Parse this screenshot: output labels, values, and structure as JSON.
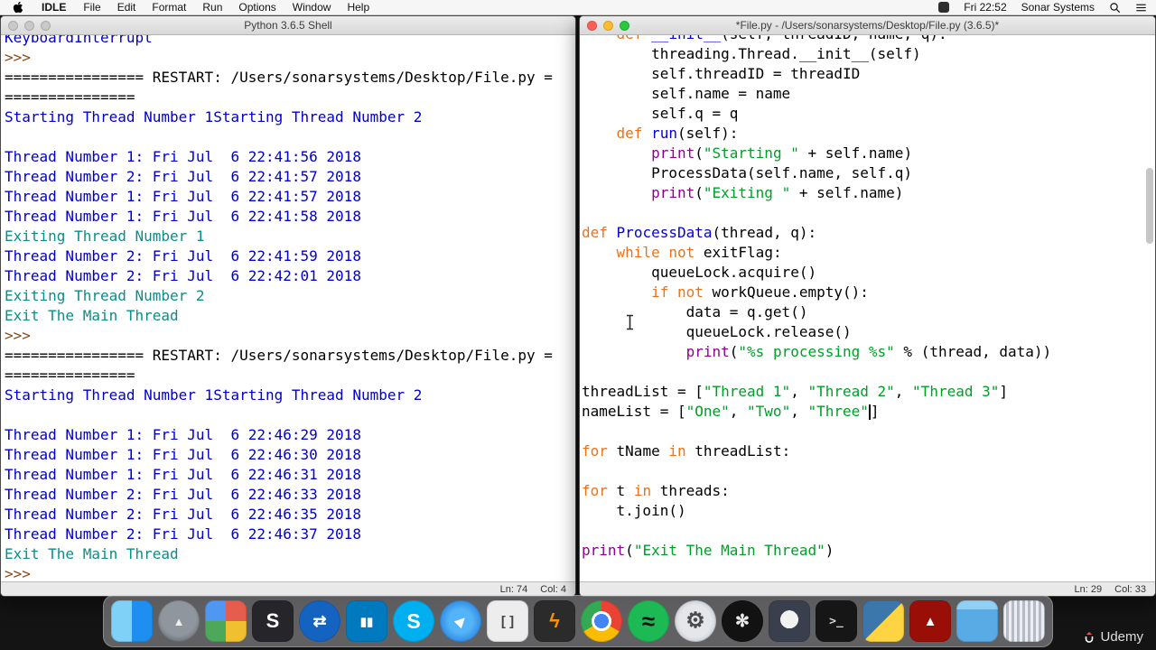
{
  "menubar": {
    "app": "IDLE",
    "menus": [
      "File",
      "Edit",
      "Format",
      "Run",
      "Options",
      "Window",
      "Help"
    ],
    "right": {
      "time": "Fri 22:52",
      "user": "Sonar Systems"
    }
  },
  "colors": {
    "kw": "#e8731c",
    "def": "#0000e0",
    "str": "#00a028",
    "bi": "#900090",
    "pl": "#000000",
    "out": "#0000cd",
    "ex": "#0e8c86",
    "pr": "#8b4513"
  },
  "shell_window": {
    "title": "Python 3.6.5 Shell",
    "status_ln": "Ln: 74",
    "status_col": "Col: 4",
    "lines": [
      [
        [
          "out",
          "KeyboardInterrupt"
        ]
      ],
      [
        [
          "pr",
          ">>> "
        ]
      ],
      [
        [
          "pl",
          "================ RESTART: /Users/sonarsystems/Desktop/File.py ="
        ]
      ],
      [
        [
          "pl",
          "==============="
        ]
      ],
      [
        [
          "out",
          "Starting Thread Number 1Starting Thread Number 2"
        ]
      ],
      [],
      [
        [
          "out",
          "Thread Number 1: Fri Jul  6 22:41:56 2018"
        ]
      ],
      [
        [
          "out",
          "Thread Number 2: Fri Jul  6 22:41:57 2018"
        ]
      ],
      [
        [
          "out",
          "Thread Number 1: Fri Jul  6 22:41:57 2018"
        ]
      ],
      [
        [
          "out",
          "Thread Number 1: Fri Jul  6 22:41:58 2018"
        ]
      ],
      [
        [
          "ex",
          "Exiting Thread Number 1"
        ]
      ],
      [
        [
          "out",
          "Thread Number 2: Fri Jul  6 22:41:59 2018"
        ]
      ],
      [
        [
          "out",
          "Thread Number 2: Fri Jul  6 22:42:01 2018"
        ]
      ],
      [
        [
          "ex",
          "Exiting Thread Number 2"
        ]
      ],
      [
        [
          "ex",
          "Exit The Main Thread"
        ]
      ],
      [
        [
          "pr",
          ">>> "
        ]
      ],
      [
        [
          "pl",
          "================ RESTART: /Users/sonarsystems/Desktop/File.py ="
        ]
      ],
      [
        [
          "pl",
          "==============="
        ]
      ],
      [
        [
          "out",
          "Starting Thread Number 1Starting Thread Number 2"
        ]
      ],
      [],
      [
        [
          "out",
          "Thread Number 1: Fri Jul  6 22:46:29 2018"
        ]
      ],
      [
        [
          "out",
          "Thread Number 1: Fri Jul  6 22:46:30 2018"
        ]
      ],
      [
        [
          "out",
          "Thread Number 1: Fri Jul  6 22:46:31 2018"
        ]
      ],
      [
        [
          "out",
          "Thread Number 2: Fri Jul  6 22:46:33 2018"
        ]
      ],
      [
        [
          "out",
          "Thread Number 2: Fri Jul  6 22:46:35 2018"
        ]
      ],
      [
        [
          "out",
          "Thread Number 2: Fri Jul  6 22:46:37 2018"
        ]
      ],
      [
        [
          "ex",
          "Exit The Main Thread"
        ]
      ],
      [
        [
          "pr",
          ">>> "
        ]
      ]
    ]
  },
  "editor_window": {
    "title": "*File.py - /Users/sonarsystems/Desktop/File.py (3.6.5)*",
    "status_ln": "Ln: 29",
    "status_col": "Col: 33",
    "lines": [
      [
        [
          "pl",
          "    "
        ],
        [
          "kw",
          "def"
        ],
        [
          "pl",
          " "
        ],
        [
          "def",
          "__init__"
        ],
        [
          "pl",
          "(self, threadID, name, q):"
        ]
      ],
      [
        [
          "pl",
          "        threading.Thread.__init__(self)"
        ]
      ],
      [
        [
          "pl",
          "        self.threadID = threadID"
        ]
      ],
      [
        [
          "pl",
          "        self.name = name"
        ]
      ],
      [
        [
          "pl",
          "        self.q = q"
        ]
      ],
      [
        [
          "pl",
          "    "
        ],
        [
          "kw",
          "def"
        ],
        [
          "pl",
          " "
        ],
        [
          "def",
          "run"
        ],
        [
          "pl",
          "(self):"
        ]
      ],
      [
        [
          "pl",
          "        "
        ],
        [
          "bi",
          "print"
        ],
        [
          "pl",
          "("
        ],
        [
          "str",
          "\"Starting \""
        ],
        [
          "pl",
          " + self.name)"
        ]
      ],
      [
        [
          "pl",
          "        ProcessData(self.name, self.q)"
        ]
      ],
      [
        [
          "pl",
          "        "
        ],
        [
          "bi",
          "print"
        ],
        [
          "pl",
          "("
        ],
        [
          "str",
          "\"Exiting \""
        ],
        [
          "pl",
          " + self.name)"
        ]
      ],
      [],
      [
        [
          "kw",
          "def"
        ],
        [
          "pl",
          " "
        ],
        [
          "def",
          "ProcessData"
        ],
        [
          "pl",
          "(thread, q):"
        ]
      ],
      [
        [
          "pl",
          "    "
        ],
        [
          "kw",
          "while"
        ],
        [
          "pl",
          " "
        ],
        [
          "kw",
          "not"
        ],
        [
          "pl",
          " exitFlag:"
        ]
      ],
      [
        [
          "pl",
          "        queueLock.acquire()"
        ]
      ],
      [
        [
          "pl",
          "        "
        ],
        [
          "kw",
          "if"
        ],
        [
          "pl",
          " "
        ],
        [
          "kw",
          "not"
        ],
        [
          "pl",
          " workQueue.empty():"
        ]
      ],
      [
        [
          "pl",
          "            data = q.get()"
        ]
      ],
      [
        [
          "pl",
          "            queueLock.release()"
        ]
      ],
      [
        [
          "pl",
          "            "
        ],
        [
          "bi",
          "print"
        ],
        [
          "pl",
          "("
        ],
        [
          "str",
          "\"%s processing %s\""
        ],
        [
          "pl",
          " % (thread, data))"
        ]
      ],
      [],
      [
        [
          "pl",
          "threadList = ["
        ],
        [
          "str",
          "\"Thread 1\""
        ],
        [
          "pl",
          ", "
        ],
        [
          "str",
          "\"Thread 2\""
        ],
        [
          "pl",
          ", "
        ],
        [
          "str",
          "\"Thread 3\""
        ],
        [
          "pl",
          "]"
        ]
      ],
      [
        [
          "pl",
          "nameList = ["
        ],
        [
          "str",
          "\"One\""
        ],
        [
          "pl",
          ", "
        ],
        [
          "str",
          "\"Two\""
        ],
        [
          "pl",
          ", "
        ],
        [
          "str",
          "\"Three\""
        ],
        [
          "caret",
          ""
        ],
        [
          "pl",
          "]"
        ]
      ],
      [],
      [
        [
          "kw",
          "for"
        ],
        [
          "pl",
          " tName "
        ],
        [
          "kw",
          "in"
        ],
        [
          "pl",
          " threadList:"
        ]
      ],
      [],
      [
        [
          "kw",
          "for"
        ],
        [
          "pl",
          " t "
        ],
        [
          "kw",
          "in"
        ],
        [
          "pl",
          " threads:"
        ]
      ],
      [
        [
          "pl",
          "    t.join()"
        ]
      ],
      [],
      [
        [
          "bi",
          "print"
        ],
        [
          "pl",
          "("
        ],
        [
          "str",
          "\"Exit The Main Thread\""
        ],
        [
          "pl",
          ")"
        ]
      ]
    ]
  },
  "dock": {
    "apps": [
      {
        "name": "finder",
        "label": "Finder",
        "bg": "linear-gradient(90deg,#7fd1f8 50%,#1e8ff0 50%)",
        "glyph": "",
        "gc": "#ffffff",
        "gs": 20,
        "round": false
      },
      {
        "name": "launchpad",
        "label": "Launchpad",
        "bg": "radial-gradient(circle at 50% 42%,#90969d 0 55%,#4a4f55 100%)",
        "glyph": "▲",
        "gc": "#f0f0f0",
        "gs": 13,
        "round": true
      },
      {
        "name": "tiles-app",
        "label": "Tiles",
        "bg": "conic-gradient(#e45d4d 0 90deg,#f0c030 90deg 180deg,#4ea85a 180deg 270deg,#4f97f0 270deg 360deg)",
        "glyph": "",
        "gc": "#ffffff",
        "gs": 0,
        "round": false
      },
      {
        "name": "s-dark-app",
        "label": "S App",
        "bg": "#26262a",
        "glyph": "S",
        "gc": "#ffffff",
        "gs": 22,
        "round": false
      },
      {
        "name": "transfer-app",
        "label": "Transfer",
        "bg": "#1563c0",
        "glyph": "⇄",
        "gc": "#ffffff",
        "gs": 18,
        "round": true
      },
      {
        "name": "trello",
        "label": "Trello",
        "bg": "#0079bf",
        "glyph": "▮▮",
        "gc": "#ffffff",
        "gs": 13,
        "round": false
      },
      {
        "name": "skype",
        "label": "Skype",
        "bg": "#00aff0",
        "glyph": "S",
        "gc": "#ffffff",
        "gs": 23,
        "round": true
      },
      {
        "name": "safari",
        "label": "Safari",
        "bg": "radial-gradient(circle,#54b4f8 0 40%,#1566cd 100%)",
        "glyph": "▸",
        "gc": "#ffffff",
        "gs": 20,
        "round": true,
        "rot": -45
      },
      {
        "name": "brackets",
        "label": "Brackets",
        "bg": "#ededed",
        "glyph": "[ ]",
        "gc": "#444444",
        "gs": 15,
        "round": false
      },
      {
        "name": "lightning-app",
        "label": "Lightning",
        "bg": "#2b2b2b",
        "glyph": "ϟ",
        "gc": "#ff9100",
        "gs": 22,
        "round": false
      },
      {
        "name": "chrome",
        "label": "Chrome",
        "bg": "radial-gradient(circle,#4285f4 0 8px,#ffffff 8px 11px,rgba(0,0,0,0) 11px),conic-gradient(#ea4335 0 120deg,#fbbc05 120deg 240deg,#34a853 240deg 360deg)",
        "glyph": "",
        "gc": "#ffffff",
        "gs": 0,
        "round": true
      },
      {
        "name": "spotify",
        "label": "Spotify",
        "bg": "#1db954",
        "glyph": "≈",
        "gc": "#101010",
        "gs": 26,
        "round": true
      },
      {
        "name": "system-preferences",
        "label": "System Preferences",
        "bg": "radial-gradient(circle,#e4e6e9 0 55%,#a6abb2 100%)",
        "glyph": "⚙",
        "gc": "#4a4a4a",
        "gs": 24,
        "round": true
      },
      {
        "name": "obs",
        "label": "OBS",
        "bg": "#121212",
        "glyph": "✻",
        "gc": "#eaeaea",
        "gs": 19,
        "round": true
      },
      {
        "name": "github",
        "label": "GitHub",
        "bg": "radial-gradient(circle at 50% 46%,#f2f2f2 0 10px,#3a3f4d 10px)",
        "glyph": "",
        "gc": "#ffffff",
        "gs": 0,
        "round": false
      },
      {
        "name": "terminal",
        "label": "Terminal",
        "bg": "#161616",
        "glyph": ">_",
        "gc": "#d5d5d5",
        "gs": 13,
        "round": false,
        "mono": true
      },
      {
        "name": "python-idle",
        "label": "Python IDLE",
        "bg": "linear-gradient(135deg,#3b77aa 0 50%,#ffd443 50% 100%)",
        "glyph": "",
        "gc": "#ffffff",
        "gs": 0,
        "round": false
      },
      {
        "name": "acrobat",
        "label": "Adobe Acrobat",
        "bg": "#990f08",
        "glyph": "▲",
        "gc": "#ffffff",
        "gs": 15,
        "round": false
      },
      {
        "name": "files-folder",
        "label": "Files",
        "bg": "linear-gradient(180deg,#8fd0f5 0 22%,#58abe4 22% 100%)",
        "glyph": "",
        "gc": "#ffffff",
        "gs": 0,
        "round": false
      },
      {
        "name": "trash",
        "label": "Trash",
        "bg": "repeating-linear-gradient(90deg,#eceef2 0 3px,#b6bac4 3px 6px)",
        "glyph": "",
        "gc": "#ffffff",
        "gs": 0,
        "round": false
      }
    ]
  },
  "watermark": {
    "label": "Udemy"
  }
}
